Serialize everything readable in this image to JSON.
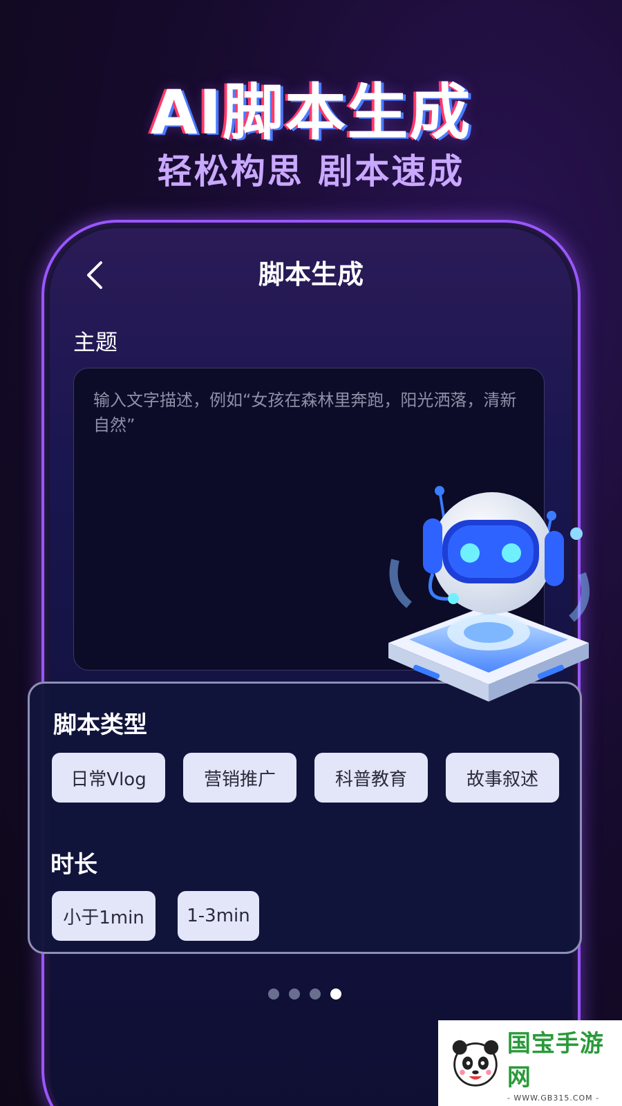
{
  "hero": {
    "title": "AI脚本生成",
    "subtitle": "轻松构思 剧本速成"
  },
  "app": {
    "nav_title": "脚本生成",
    "back_icon": "chevron-left-icon",
    "topic": {
      "label": "主题",
      "placeholder": "输入文字描述，例如“女孩在森林里奔跑，阳光洒落，清新自然”"
    },
    "script_type": {
      "label": "脚本类型",
      "options": [
        "日常Vlog",
        "营销推广",
        "科普教育",
        "故事叙述"
      ]
    },
    "duration": {
      "label": "时长",
      "options": [
        "小于1min",
        "1-3min"
      ]
    }
  },
  "pagination": {
    "total": 4,
    "active": 4
  },
  "watermark": {
    "logo_text": "国宝手游网",
    "url": "- WWW.GB315.COM -"
  },
  "colors": {
    "accent_purple": "#9a57ff",
    "chip_bg": "#e3e6f8",
    "subtitle": "#c9a8ff"
  }
}
